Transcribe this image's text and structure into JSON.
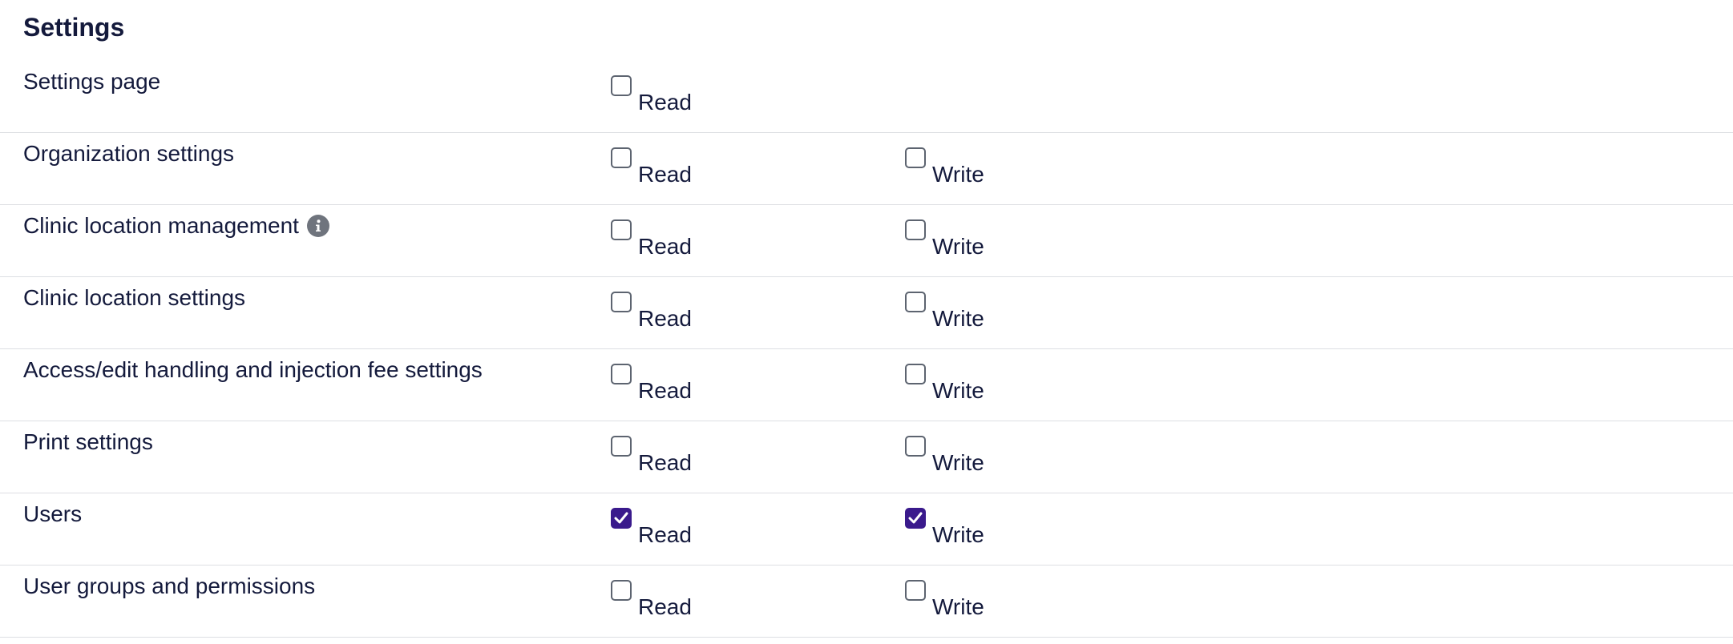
{
  "section": {
    "title": "Settings"
  },
  "rows": [
    {
      "label": "Settings page",
      "read_label": "Read",
      "read_checked": false,
      "has_info": false
    },
    {
      "label": "Organization settings",
      "read_label": "Read",
      "read_checked": false,
      "write_label": "Write",
      "write_checked": false,
      "has_info": false
    },
    {
      "label": "Clinic location management",
      "read_label": "Read",
      "read_checked": false,
      "write_label": "Write",
      "write_checked": false,
      "has_info": true,
      "info_icon": "info-icon"
    },
    {
      "label": "Clinic location settings",
      "read_label": "Read",
      "read_checked": false,
      "write_label": "Write",
      "write_checked": false,
      "has_info": false
    },
    {
      "label": "Access/edit handling and injection fee settings",
      "read_label": "Read",
      "read_checked": false,
      "write_label": "Write",
      "write_checked": false,
      "has_info": false
    },
    {
      "label": "Print settings",
      "read_label": "Read",
      "read_checked": false,
      "write_label": "Write",
      "write_checked": false,
      "has_info": false
    },
    {
      "label": "Users",
      "read_label": "Read",
      "read_checked": true,
      "write_label": "Write",
      "write_checked": true,
      "has_info": false
    },
    {
      "label": "User groups and permissions",
      "read_label": "Read",
      "read_checked": false,
      "write_label": "Write",
      "write_checked": false,
      "has_info": false
    }
  ],
  "colors": {
    "text": "#141a3c",
    "checkbox_checked": "#3a1a8c",
    "divider": "#dddfe3",
    "info_icon": "#6f747d"
  }
}
